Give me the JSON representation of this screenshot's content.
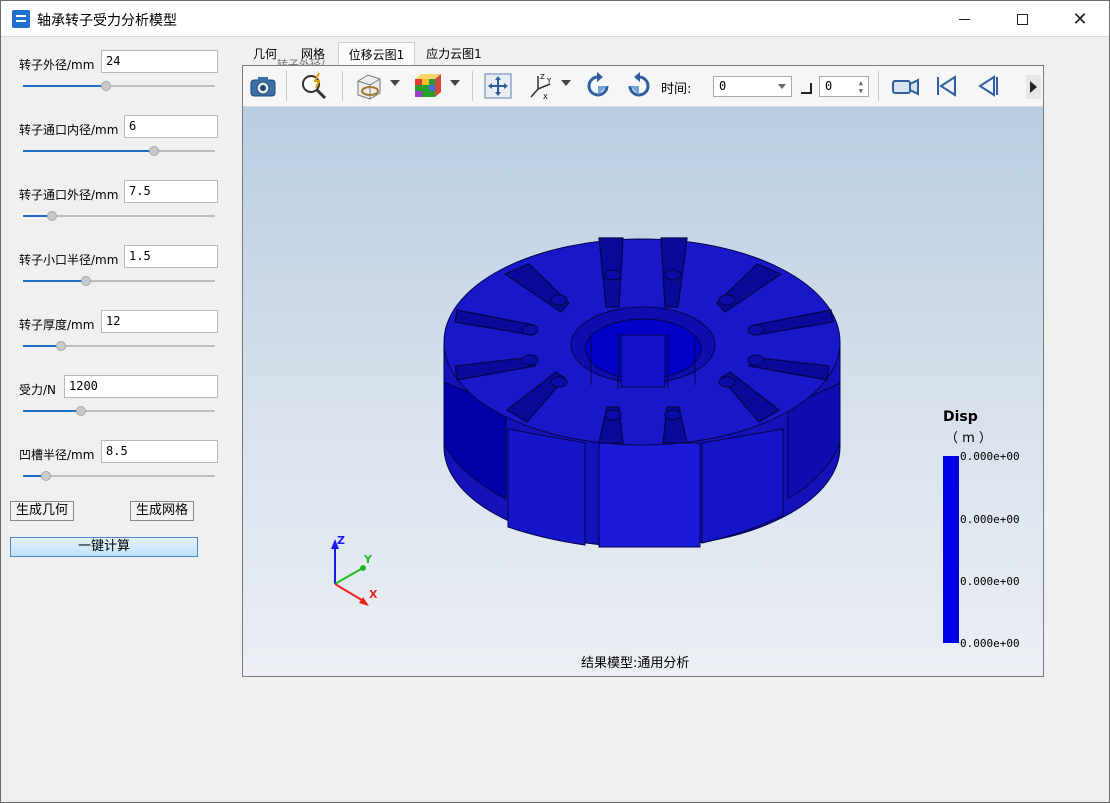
{
  "window": {
    "title": "轴承转子受力分析模型"
  },
  "params": [
    {
      "label": "转子外径/mm",
      "value": "24"
    },
    {
      "label": "转子通口内径/mm",
      "value": "6"
    },
    {
      "label": "转子通口外径/mm",
      "value": "7.5"
    },
    {
      "label": "转子小口半径/mm",
      "value": "1.5"
    },
    {
      "label": "转子厚度/mm",
      "value": "12"
    },
    {
      "label": "受力/N",
      "value": "1200"
    },
    {
      "label": "凹槽半径/mm",
      "value": "8.5"
    }
  ],
  "slider_levels": [
    0.43,
    0.68,
    0.15,
    0.33,
    0.2,
    0.3,
    0.12
  ],
  "buttons": {
    "gen_geometry": "生成几何",
    "gen_mesh": "生成网格",
    "one_click": "一键计算"
  },
  "tabs": [
    {
      "label": "几何",
      "active": false
    },
    {
      "label": "网格",
      "active": false
    },
    {
      "label": "位移云图1",
      "active": true
    },
    {
      "label": "应力云图1",
      "active": false
    }
  ],
  "tab_overflow_text": "转子外径/",
  "toolbar": {
    "time_label": "时间:",
    "time_value": "0",
    "step_value": "0"
  },
  "viewport": {
    "caption": "结果模型:通用分析",
    "axes": {
      "x": "X",
      "y": "Y",
      "z": "Z"
    }
  },
  "legend": {
    "title": "Disp",
    "unit": "（ m ）",
    "ticks": [
      "0.000e+00",
      "0.000e+00",
      "0.000e+00",
      "0.000e+00"
    ],
    "color": "#0000e6"
  }
}
